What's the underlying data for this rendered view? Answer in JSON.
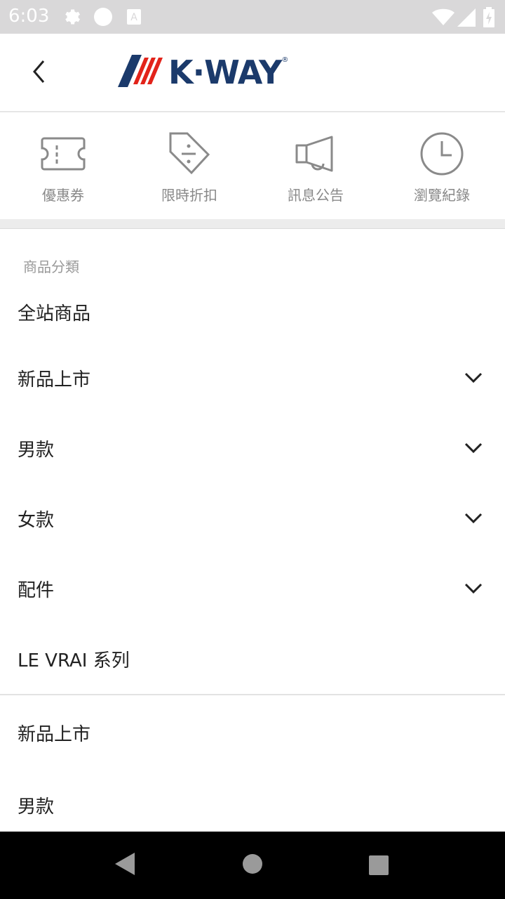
{
  "status_bar": {
    "time": "6:03",
    "icons": [
      "gear-icon",
      "circle-icon",
      "keyboard-a-icon",
      "wifi-icon",
      "signal-icon",
      "battery-charging-icon"
    ]
  },
  "header": {
    "back_icon": "chevron-left-icon",
    "logo_text": "K·WAY",
    "logo_mark": "®",
    "brand_colors": {
      "navy": "#1b3a6b",
      "red": "#e2231a"
    }
  },
  "shortcuts": [
    {
      "label": "優惠券",
      "icon": "coupon-ticket-icon"
    },
    {
      "label": "限時折扣",
      "icon": "discount-tag-icon"
    },
    {
      "label": "訊息公告",
      "icon": "megaphone-icon"
    },
    {
      "label": "瀏覽紀錄",
      "icon": "clock-icon"
    }
  ],
  "category_section": {
    "title": "商品分類",
    "items": [
      {
        "label": "全站商品",
        "expandable": false
      },
      {
        "label": "新品上市",
        "expandable": true
      },
      {
        "label": "男款",
        "expandable": true
      },
      {
        "label": "女款",
        "expandable": true
      },
      {
        "label": "配件",
        "expandable": true
      },
      {
        "label": "LE VRAI 系列",
        "expandable": false
      }
    ]
  },
  "extra_links": [
    {
      "label": "新品上市"
    },
    {
      "label": "男款"
    }
  ],
  "nav_bar": {
    "icons": [
      "back-triangle-icon",
      "home-circle-icon",
      "recents-square-icon"
    ]
  }
}
